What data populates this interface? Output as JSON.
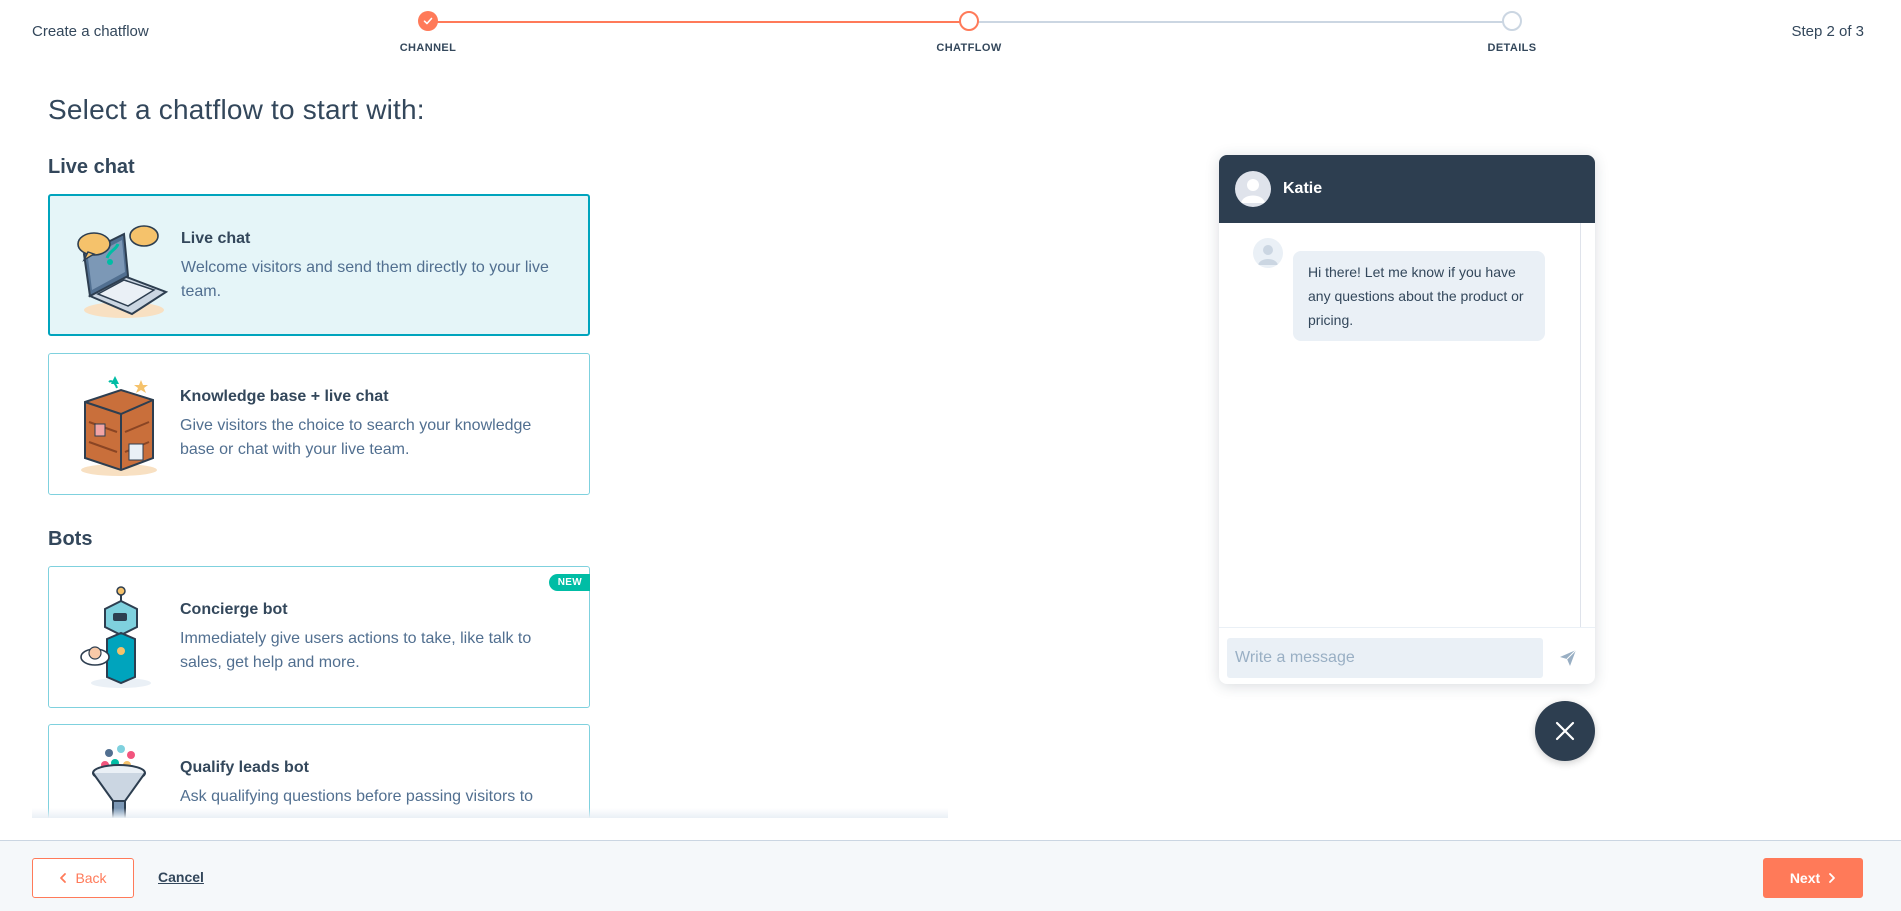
{
  "header": {
    "title": "Create a chatflow",
    "step_text": "Step 2 of 3",
    "steps": [
      {
        "label": "CHANNEL",
        "state": "complete"
      },
      {
        "label": "CHATFLOW",
        "state": "active"
      },
      {
        "label": "DETAILS",
        "state": "pending"
      }
    ]
  },
  "main": {
    "heading": "Select a chatflow to start with:",
    "sections": [
      {
        "title": "Live chat",
        "cards": [
          {
            "title": "Live chat",
            "description": "Welcome visitors and send them directly to your live team.",
            "selected": true,
            "icon": "laptop-chat-illustration-icon"
          },
          {
            "title": "Knowledge base + live chat",
            "description": "Give visitors the choice to search your knowledge base or chat with your live team.",
            "selected": false,
            "icon": "bookshelf-illustration-icon"
          }
        ]
      },
      {
        "title": "Bots",
        "cards": [
          {
            "title": "Concierge bot",
            "description": "Immediately give users actions to take, like talk to sales, get help and more.",
            "selected": false,
            "badge": "NEW",
            "icon": "robot-illustration-icon"
          },
          {
            "title": "Qualify leads bot",
            "description": "Ask qualifying questions before passing visitors to",
            "selected": false,
            "icon": "funnel-illustration-icon"
          }
        ]
      }
    ]
  },
  "chat_preview": {
    "agent_name": "Katie",
    "message": "Hi there! Let me know if you have any questions about the product or pricing.",
    "input_placeholder": "Write a message"
  },
  "footer": {
    "back_label": "Back",
    "cancel_label": "Cancel",
    "next_label": "Next"
  },
  "colors": {
    "accent": "#ff7a59",
    "teal": "#00a4bd",
    "dark": "#2d3e50",
    "text": "#33475b",
    "badge": "#00bda5"
  }
}
